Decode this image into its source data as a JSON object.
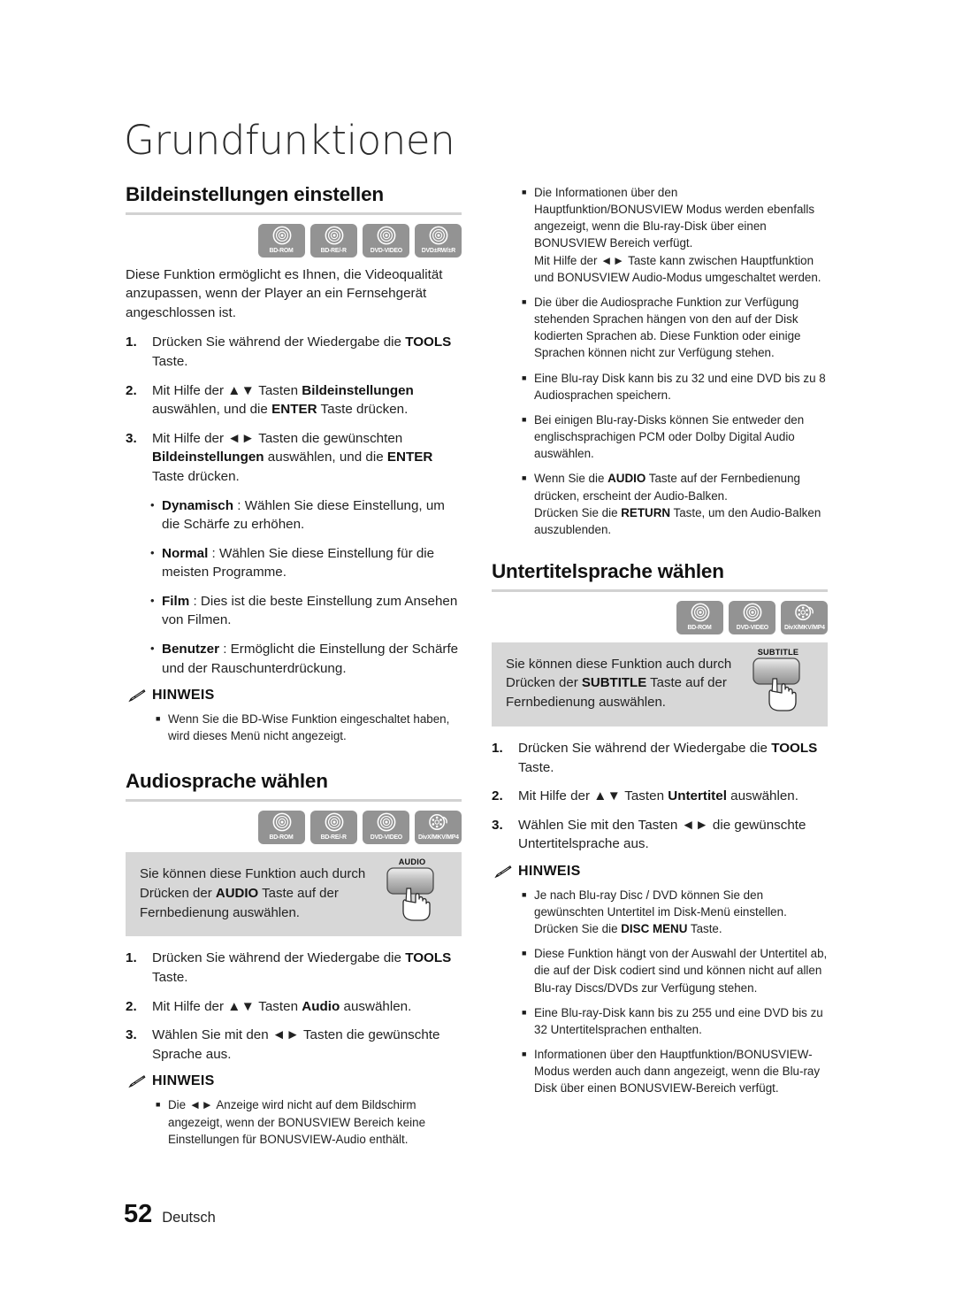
{
  "document": {
    "title": "Grundfunktionen",
    "footer": {
      "page_number": "52",
      "language": "Deutsch"
    },
    "colors": {
      "badge_gray": "#939393",
      "tipbox_gray": "#d7d7d7",
      "rule_gray": "#d2d2d2",
      "text": "#222222"
    }
  },
  "sections": {
    "picture_settings": {
      "heading": "Bildeinstellungen einstellen",
      "badges": [
        {
          "label": "BD-ROM",
          "icon": "disc-icon"
        },
        {
          "label": "BD-RE/-R",
          "icon": "disc-icon"
        },
        {
          "label": "DVD-VIDEO",
          "icon": "disc-icon"
        },
        {
          "label": "DVD±RW/±R",
          "icon": "disc-icon"
        }
      ],
      "intro": "Diese Funktion ermöglicht es Ihnen, die Videoqualität anzupassen, wenn der Player an ein Fernsehgerät angeschlossen ist.",
      "steps": [
        {
          "num": "1.",
          "text_html": "Drücken Sie während der Wiedergabe die <b>TOOLS</b> Taste."
        },
        {
          "num": "2.",
          "text_html": "Mit Hilfe der <span class=\"arrows\">▲▼</span> Tasten <b>Bildeinstellungen</b> auswählen, und die <b>ENTER</b> Taste drücken."
        },
        {
          "num": "3.",
          "text_html": "Mit Hilfe der <span class=\"arrows\">◄►</span> Tasten die gewünschten <b>Bildeinstellungen</b> auswählen, und die <b>ENTER</b> Taste drücken."
        }
      ],
      "options": [
        {
          "text_html": "<b>Dynamisch</b> : Wählen Sie diese Einstellung, um die Schärfe zu erhöhen."
        },
        {
          "text_html": "<b>Normal</b> : Wählen Sie diese Einstellung für die meisten Programme."
        },
        {
          "text_html": "<b>Film</b> : Dies ist die beste Einstellung zum Ansehen von Filmen."
        },
        {
          "text_html": "<b>Benutzer</b> : Ermöglicht die Einstellung der Schärfe und der Rauschunterdrückung."
        }
      ],
      "note": {
        "label": "HINWEIS",
        "items": [
          {
            "text_html": "Wenn Sie die BD-Wise Funktion eingeschaltet haben, wird dieses Menü nicht angezeigt."
          }
        ]
      }
    },
    "audio_language": {
      "heading": "Audiosprache wählen",
      "badges": [
        {
          "label": "BD-ROM",
          "icon": "disc-icon"
        },
        {
          "label": "BD-RE/-R",
          "icon": "disc-icon"
        },
        {
          "label": "DVD-VIDEO",
          "icon": "disc-icon"
        },
        {
          "label": "DivX/MKV/MP4",
          "icon": "film-reel-icon"
        }
      ],
      "tip": {
        "text_html": "Sie können diese Funktion auch durch Drücken der <b>AUDIO</b> Taste auf der Fernbedienung auswählen.",
        "remote_key_label": "AUDIO"
      },
      "steps": [
        {
          "num": "1.",
          "text_html": "Drücken Sie während der Wiedergabe die <b>TOOLS</b> Taste."
        },
        {
          "num": "2.",
          "text_html": "Mit Hilfe der <span class=\"arrows\">▲▼</span> Tasten <b>Audio</b> auswählen."
        },
        {
          "num": "3.",
          "text_html": "Wählen Sie mit den <span class=\"arrows\">◄►</span> Tasten die gewünschte Sprache aus."
        }
      ],
      "note": {
        "label": "HINWEIS",
        "items": [
          {
            "text_html": "Die <span class=\"arrows\">◄►</span> Anzeige wird nicht auf dem Bildschirm angezeigt, wenn der BONUSVIEW Bereich keine Einstellungen für BONUSVIEW-Audio enthält."
          }
        ]
      }
    },
    "audio_notes_continued": {
      "items": [
        {
          "text_html": "Die Informationen über den Hauptfunktion/BONUSVIEW Modus werden ebenfalls angezeigt, wenn die Blu-ray-Disk über einen BONUSVIEW Bereich verfügt.<br>Mit Hilfe der <span class=\"arrows\">◄►</span> Taste kann zwischen Hauptfunktion und BONUSVIEW Audio-Modus umgeschaltet werden."
        },
        {
          "text_html": "Die über die Audiosprache Funktion zur Verfügung stehenden Sprachen hängen von den auf der Disk kodierten Sprachen ab. Diese Funktion oder einige Sprachen können nicht zur Verfügung stehen."
        },
        {
          "text_html": "Eine Blu-ray Disk kann bis zu 32 und eine DVD bis zu 8 Audiosprachen speichern."
        },
        {
          "text_html": "Bei einigen Blu-ray-Disks können Sie entweder den englischsprachigen PCM oder Dolby Digital Audio auswählen."
        },
        {
          "text_html": "Wenn Sie die <b>AUDIO</b> Taste auf der Fernbedienung drücken, erscheint der Audio-Balken.<br>Drücken Sie die <b>RETURN</b> Taste, um den Audio-Balken auszublenden."
        }
      ]
    },
    "subtitle_language": {
      "heading": "Untertitelsprache wählen",
      "badges": [
        {
          "label": "BD-ROM",
          "icon": "disc-icon"
        },
        {
          "label": "DVD-VIDEO",
          "icon": "disc-icon"
        },
        {
          "label": "DivX/MKV/MP4",
          "icon": "film-reel-icon"
        }
      ],
      "tip": {
        "text_html": "Sie können diese Funktion auch durch Drücken der <b>SUBTITLE</b> Taste auf der Fernbedienung auswählen.",
        "remote_key_label": "SUBTITLE"
      },
      "steps": [
        {
          "num": "1.",
          "text_html": "Drücken Sie während der Wiedergabe die <b>TOOLS</b> Taste."
        },
        {
          "num": "2.",
          "text_html": "Mit Hilfe der <span class=\"arrows\">▲▼</span> Tasten <b>Untertitel</b> auswählen."
        },
        {
          "num": "3.",
          "text_html": "Wählen Sie mit den Tasten <span class=\"arrows\">◄►</span> die gewünschte Untertitelsprache aus."
        }
      ],
      "note": {
        "label": "HINWEIS",
        "items": [
          {
            "text_html": "Je nach Blu-ray Disc / DVD können Sie den gewünschten Untertitel im Disk-Menü einstellen. Drücken Sie die <b>DISC MENU</b> Taste."
          },
          {
            "text_html": "Diese Funktion hängt von der Auswahl der Untertitel ab, die auf der Disk codiert sind und können nicht auf allen Blu-ray Discs/DVDs zur Verfügung stehen."
          },
          {
            "text_html": "Eine Blu-ray-Disk kann bis zu 255 und eine DVD bis zu 32 Untertitelsprachen enthalten."
          },
          {
            "text_html": "Informationen über den Hauptfunktion/BONUSVIEW-Modus werden auch dann angezeigt, wenn die Blu-ray Disk über einen BONUSVIEW-Bereich verfügt."
          }
        ]
      }
    }
  }
}
